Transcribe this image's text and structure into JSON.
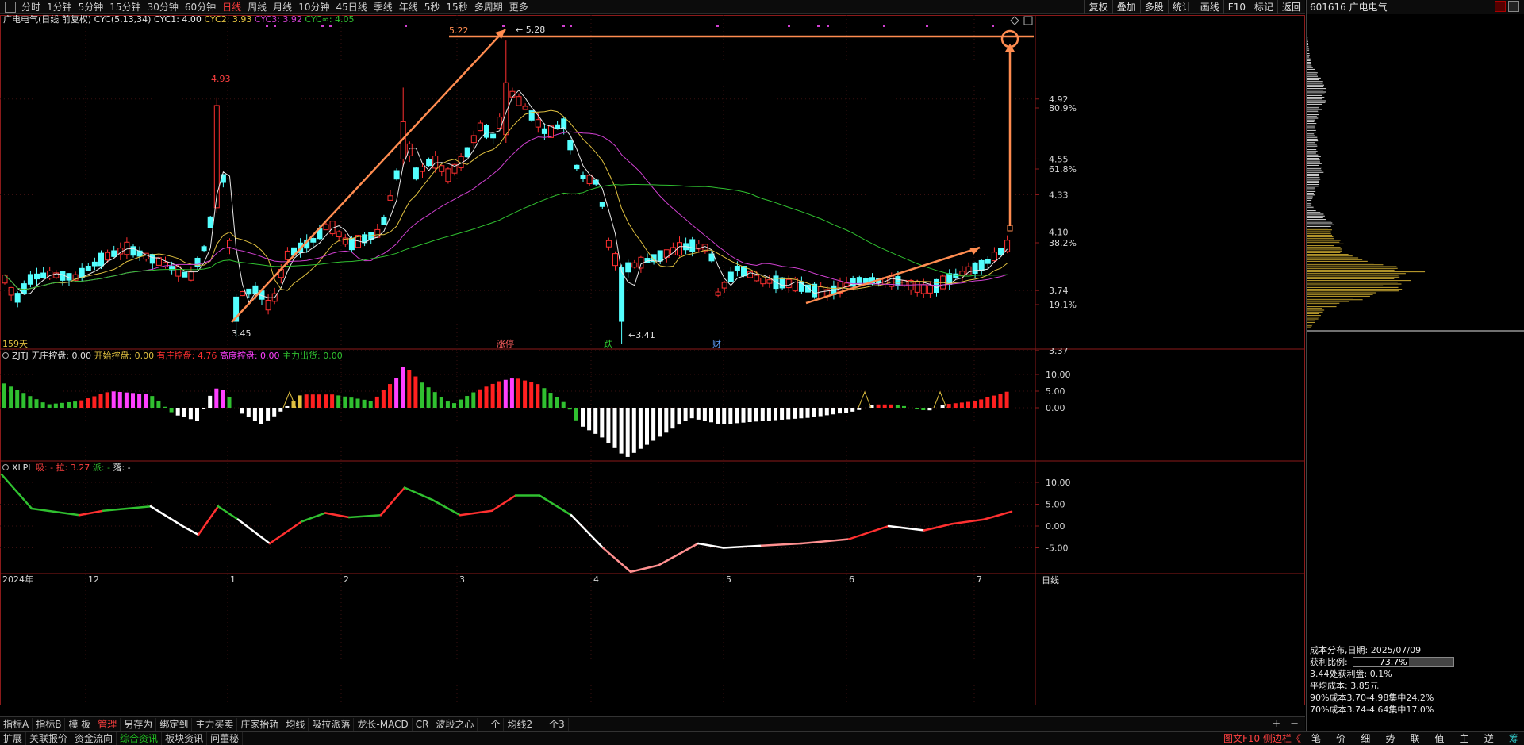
{
  "toolbar": {
    "timeframes": [
      "分时",
      "1分钟",
      "5分钟",
      "15分钟",
      "30分钟",
      "60分钟",
      "日线",
      "周线",
      "月线",
      "10分钟",
      "45日线",
      "季线",
      "年线",
      "5秒",
      "15秒",
      "多周期",
      "更多"
    ],
    "active_timeframe": "日线",
    "right_buttons": [
      "复权",
      "叠加",
      "多股",
      "统计",
      "画线",
      "F10",
      "标记",
      "返回"
    ]
  },
  "stock": {
    "code": "601616",
    "name": "广电电气"
  },
  "main_chart": {
    "title": "广电电气(日线 前复权)",
    "indicator_name": "CYC(5,13,34)",
    "indicator_values": [
      {
        "label": "CYC1: 4.00",
        "color": "#e8e8e8"
      },
      {
        "label": "CYC2: 3.93",
        "color": "#e0c040"
      },
      {
        "label": "CYC3: 3.92",
        "color": "#d040d0"
      },
      {
        "label": "CYC∞: 4.05",
        "color": "#30c030"
      }
    ],
    "y_ticks": [
      "4.92",
      "80.9%",
      "4.55",
      "61.8%",
      "4.33",
      "4.10",
      "38.2%",
      "3.74",
      "19.1%",
      "3.37"
    ],
    "price_labels": {
      "high1": "4.93",
      "low1": "3.45",
      "peak_left": "5.22",
      "peak": "5.28",
      "low2": "3.41"
    },
    "period_label": "159天",
    "event_tags": [
      {
        "text": "涨停",
        "color": "#ff6060"
      },
      {
        "text": "跌",
        "color": "#30d030"
      },
      {
        "text": "财",
        "color": "#60a0ff"
      }
    ],
    "colors": {
      "up": "#ff3030",
      "down": "#54ffff",
      "cyc1": "#e8e8e8",
      "cyc2": "#e0c040",
      "cyc3": "#d040d0",
      "cycinf": "#30c030",
      "annotation": "#ff8c50"
    }
  },
  "zjtj_panel": {
    "name": "ZJTJ",
    "items": [
      {
        "label": "无庄控盘: 0.00",
        "color": "#e0e0e0"
      },
      {
        "label": "开始控盘: 0.00",
        "color": "#e0c040"
      },
      {
        "label": "有庄控盘: 4.76",
        "color": "#ff3030"
      },
      {
        "label": "高度控盘: 0.00",
        "color": "#ff40ff"
      },
      {
        "label": "主力出货: 0.00",
        "color": "#30c030"
      }
    ],
    "y_ticks": [
      "10.00",
      "5.00",
      "0.00"
    ]
  },
  "xlpl_panel": {
    "name": "XLPL",
    "items": [
      {
        "label": "吸: -",
        "color": "#ff4040"
      },
      {
        "label": "拉: 3.27",
        "color": "#ff4040"
      },
      {
        "label": "派: -",
        "color": "#30c030"
      },
      {
        "label": "落: -",
        "color": "#e0e0e0"
      }
    ],
    "y_ticks": [
      "10.00",
      "5.00",
      "0.00",
      "-5.00"
    ]
  },
  "x_axis": {
    "labels": [
      "2024年",
      "12",
      "1",
      "2",
      "3",
      "4",
      "5",
      "6",
      "7"
    ],
    "corner_label": "日线"
  },
  "cost_distribution": {
    "date_label": "成本分布,日期:",
    "date": "2025/07/09",
    "profit_label": "获利比例:",
    "profit_ratio": "73.7%",
    "profit_value": 0.737,
    "line3": "3.44处获利盘: 0.1%",
    "line4": "平均成本: 3.85元",
    "line5": "90%成本3.70-4.98集中24.2%",
    "line6": "70%成本3.74-4.64集中17.0%"
  },
  "bottom_tabs_row1": [
    "指标A",
    "指标B",
    "模 板",
    "管理",
    "另存为",
    "绑定到",
    "主力买卖",
    "庄家抬轿",
    "均线",
    "吸拉派落",
    "龙长-MACD",
    "CR",
    "波段之心",
    "一个",
    "均线2",
    "一个3"
  ],
  "bottom_tabs_row1_active": "管理",
  "bottom_tabs_row2": [
    "扩展",
    "关联报价",
    "资金流向",
    "综合资讯",
    "板块资讯",
    "问董秘"
  ],
  "bottom_tabs_row2_green": "综合资讯",
  "side_link": "图文F10 侧边栏《",
  "right_tabs": [
    "笔",
    "价",
    "细",
    "势",
    "联",
    "值",
    "主",
    "逆",
    "筹"
  ],
  "right_tabs_active": "筹"
}
